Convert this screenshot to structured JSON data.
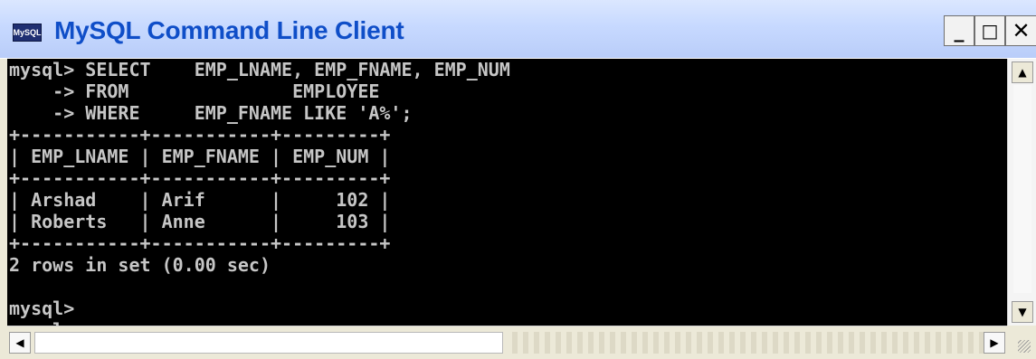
{
  "window": {
    "title": "MySQL Command Line Client",
    "app_icon_text": "MySQL",
    "controls": {
      "minimize": "_",
      "maximize": "□",
      "close": "✕"
    }
  },
  "console": {
    "lines": [
      "mysql> SELECT    EMP_LNAME, EMP_FNAME, EMP_NUM",
      "    -> FROM               EMPLOYEE",
      "    -> WHERE     EMP_FNAME LIKE 'A%';",
      "+-----------+-----------+---------+",
      "| EMP_LNAME | EMP_FNAME | EMP_NUM |",
      "+-----------+-----------+---------+",
      "| Arshad    | Arif      |     102 |",
      "| Roberts   | Anne      |     103 |",
      "+-----------+-----------+---------+",
      "2 rows in set (0.00 sec)",
      "",
      "mysql>",
      "mysql>"
    ]
  },
  "scrollbars": {
    "up_arrow": "▲",
    "down_arrow": "▼",
    "left_arrow": "◀",
    "right_arrow": "▶"
  }
}
